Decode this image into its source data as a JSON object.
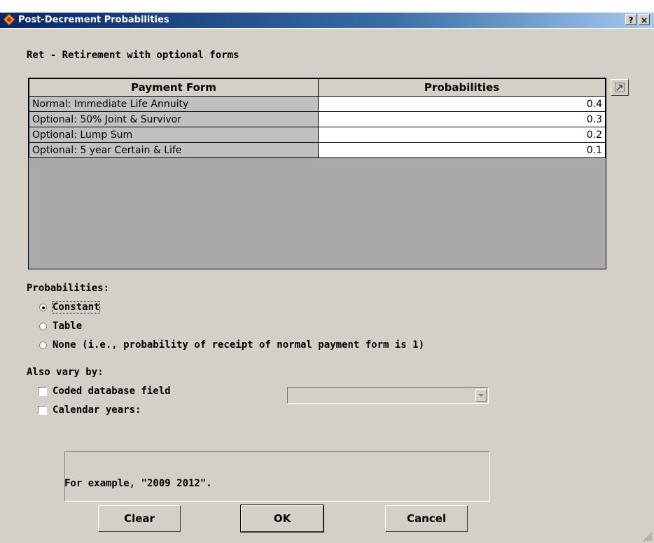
{
  "window": {
    "title": "Post-Decrement Probabilities",
    "help_label": "?",
    "close_label": "×"
  },
  "decrement_heading": "Ret - Retirement with optional forms",
  "grid": {
    "columns": [
      "Payment Form",
      "Probabilities"
    ],
    "rows": [
      {
        "form": "Normal:  Immediate Life Annuity",
        "probability": "0.4"
      },
      {
        "form": "Optional: 50% Joint & Survivor",
        "probability": "0.3"
      },
      {
        "form": "Optional: Lump Sum",
        "probability": "0.2"
      },
      {
        "form": "Optional: 5 year Certain & Life",
        "probability": "0.1"
      }
    ]
  },
  "probabilities": {
    "label": "Probabilities:",
    "options": [
      {
        "label": "Constant",
        "selected": true
      },
      {
        "label": "Table",
        "selected": false
      },
      {
        "label": "None (i.e., probability of receipt of normal payment form is 1)",
        "selected": false
      }
    ]
  },
  "also_vary": {
    "label": "Also vary by:",
    "coded_field_label": "Coded database field",
    "coded_field_checked": false,
    "coded_field_value": "",
    "calendar_years_label": "Calendar years:",
    "calendar_years_checked": false,
    "calendar_years_value": "",
    "example_text": "For example, \"2009 2012\"."
  },
  "buttons": {
    "clear": "Clear",
    "ok": "OK",
    "cancel": "Cancel"
  },
  "icons": {
    "app": "app-icon",
    "expand": "expand-grid-icon",
    "resize": "resize-grip-icon"
  }
}
